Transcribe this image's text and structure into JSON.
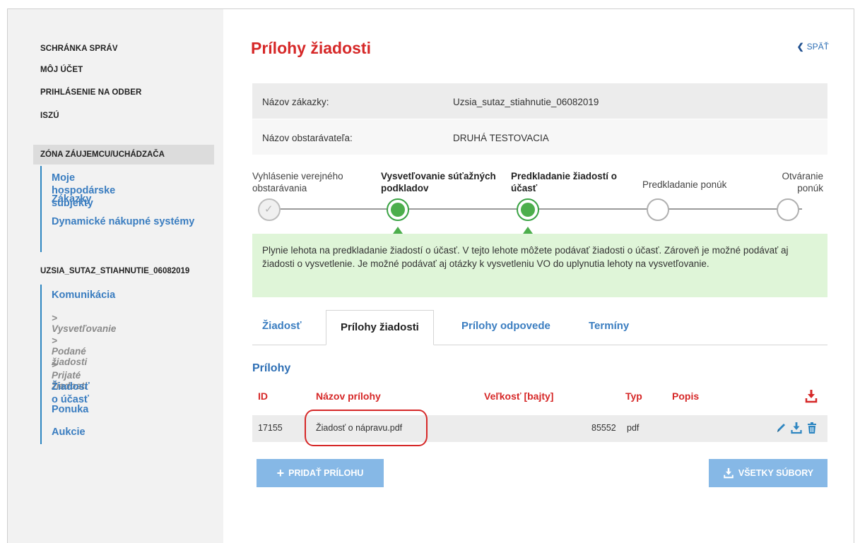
{
  "sidebar": {
    "top_links": [
      "SCHRÁNKA SPRÁV",
      "MÔJ ÚČET",
      "PRIHLÁSENIE NA ODBER",
      "ISZÚ"
    ],
    "zone_title": "ZÓNA ZÁUJEMCU/UCHÁDZAČA",
    "zone_items": [
      "Moje hospodárske subjekty",
      "Zákazky",
      "Dynamické nákupné systémy"
    ],
    "tender_title": "UZSIA_SUTAZ_STIAHNUTIE_06082019",
    "tender_items": {
      "komunikacia": "Komunikácia",
      "vysvetlovanie": "> Vysvetľovanie",
      "podane": "> Podané žiadosti",
      "prijate": "> Prijaté žiadosti",
      "ziadost": "Žiadosť o účasť",
      "ponuka": "Ponuka",
      "aukcie": "Aukcie"
    }
  },
  "main": {
    "title": "Prílohy žiadosti",
    "back_label": "SPÄŤ",
    "info": [
      {
        "label": "Názov zákazky:",
        "value": "Uzsia_sutaz_stiahnutie_06082019"
      },
      {
        "label": "Názov obstarávateľa:",
        "value": "DRUHÁ TESTOVACIA"
      }
    ],
    "steps": [
      {
        "label": "Vyhlásenie verejného obstarávania",
        "state": "done"
      },
      {
        "label": "Vysvetľovanie súťažných podkladov",
        "state": "active"
      },
      {
        "label": "Predkladanie žiadostí o účasť",
        "state": "active"
      },
      {
        "label": "Predkladanie ponúk",
        "state": "pending"
      },
      {
        "label": "Otváranie ponúk",
        "state": "pending"
      }
    ],
    "notice": "Plynie lehota na predkladanie žiadostí o účasť. V tejto lehote môžete podávať žiadosti o účasť. Zároveň je možné podávať aj žiadosti o vysvetlenie. Je možné podávať aj otázky k vysvetleniu VO do uplynutia lehoty na vysvetľovanie.",
    "tabs": [
      "Žiadosť",
      "Prílohy žiadosti",
      "Prílohy odpovede",
      "Termíny"
    ],
    "active_tab": "Prílohy žiadosti",
    "section_title": "Prílohy",
    "table": {
      "headers": [
        "ID",
        "Názov prílohy",
        "Veľkosť [bajty]",
        "Typ",
        "Popis"
      ],
      "rows": [
        {
          "id": "17155",
          "name": "Žiadosť o nápravu.pdf",
          "size": "85552",
          "type": "pdf",
          "desc": ""
        }
      ]
    },
    "buttons": {
      "add": "PRIDAŤ PRÍLOHU",
      "all": "VŠETKY SÚBORY"
    }
  },
  "colors": {
    "accent_red": "#d62828",
    "link_blue": "#3a7dc0",
    "active_green": "#4cae4c",
    "notice_bg": "#dff5d8",
    "button_blue": "#86b8e6"
  }
}
